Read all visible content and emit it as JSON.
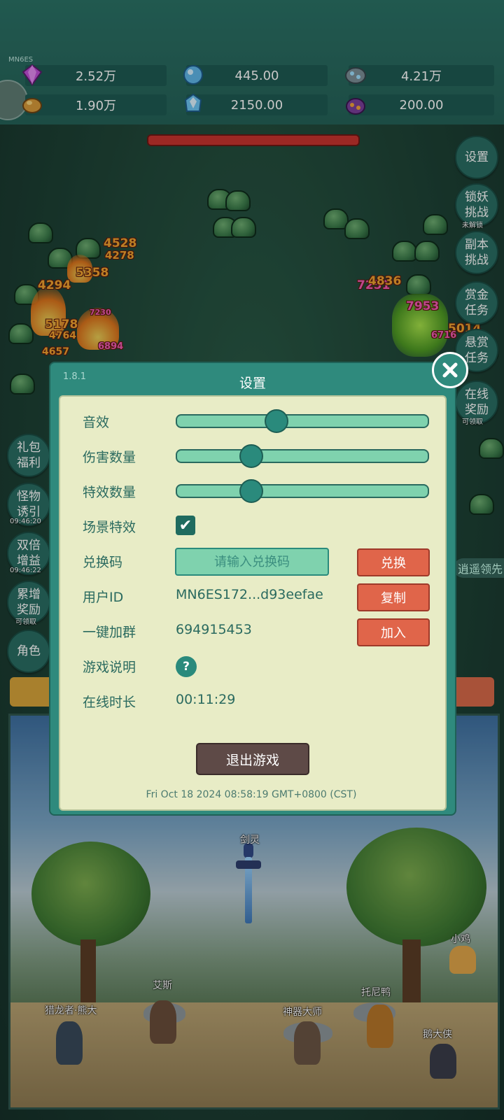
{
  "player_tag": "MN6ES",
  "resources": [
    {
      "icon": "purple-gem-icon",
      "value": "2.52万"
    },
    {
      "icon": "blue-crystal-icon",
      "value": "445.00"
    },
    {
      "icon": "ore-stone-icon",
      "value": "4.21万"
    },
    {
      "icon": "gold-nugget-icon",
      "value": "1.90万"
    },
    {
      "icon": "ice-crystal-icon",
      "value": "2150.00"
    },
    {
      "icon": "purple-pouch-icon",
      "value": "200.00"
    }
  ],
  "damage_numbers": [
    "4528",
    "4278",
    "5358",
    "4294",
    "7230",
    "5178",
    "4764",
    "4657",
    "6894",
    "7251",
    "4836",
    "7953",
    "5014",
    "6716"
  ],
  "right_menu": [
    {
      "label": "设置"
    },
    {
      "label": "锁妖挑战",
      "sub": "未解锁"
    },
    {
      "label": "副本挑战"
    },
    {
      "label": "赏金任务"
    },
    {
      "label": "悬赏任务"
    },
    {
      "label": "在线奖励",
      "sub": "可领取"
    }
  ],
  "left_menu": [
    {
      "label": "礼包福利"
    },
    {
      "label": "怪物诱引",
      "sub": "09:46:20"
    },
    {
      "label": "双倍增益",
      "sub": "09:46:22"
    },
    {
      "label": "累增奖励",
      "sub": "可领取"
    },
    {
      "label": "角色"
    }
  ],
  "hint_text": "逍遥领先",
  "settings": {
    "version": "1.8.1",
    "title": "设置",
    "sound_label": "音效",
    "sound_level": 0.39,
    "damage_count_label": "伤害数量",
    "damage_count_level": 0.29,
    "effect_count_label": "特效数量",
    "effect_count_level": 0.29,
    "scene_effect_label": "场景特效",
    "scene_effect_checked": true,
    "redeem_label": "兑换码",
    "redeem_placeholder": "请输入兑换码",
    "redeem_button": "兑换",
    "user_id_label": "用户ID",
    "user_id_value": "MN6ES172...d93eefae",
    "copy_button": "复制",
    "join_group_label": "一键加群",
    "group_number": "694915453",
    "join_button": "加入",
    "guide_label": "游戏说明",
    "guide_icon": "?",
    "online_time_label": "在线时长",
    "online_time_value": "00:11:29",
    "exit_button": "退出游戏",
    "timestamp": "Fri Oct 18 2024 08:58:19 GMT+0800 (CST)"
  },
  "characters": [
    {
      "name": "剑灵"
    },
    {
      "name": "小鸡"
    },
    {
      "name": "艾斯"
    },
    {
      "name": "托尼鸭"
    },
    {
      "name": "猎龙者·熊大"
    },
    {
      "name": "神器大师"
    },
    {
      "name": "鹅大侠"
    }
  ],
  "colors": {
    "panel_teal": "#2f8a7d",
    "panel_cream": "#e8ecc6",
    "button_red": "#e0654a",
    "exit_brown": "#5e4a47"
  }
}
